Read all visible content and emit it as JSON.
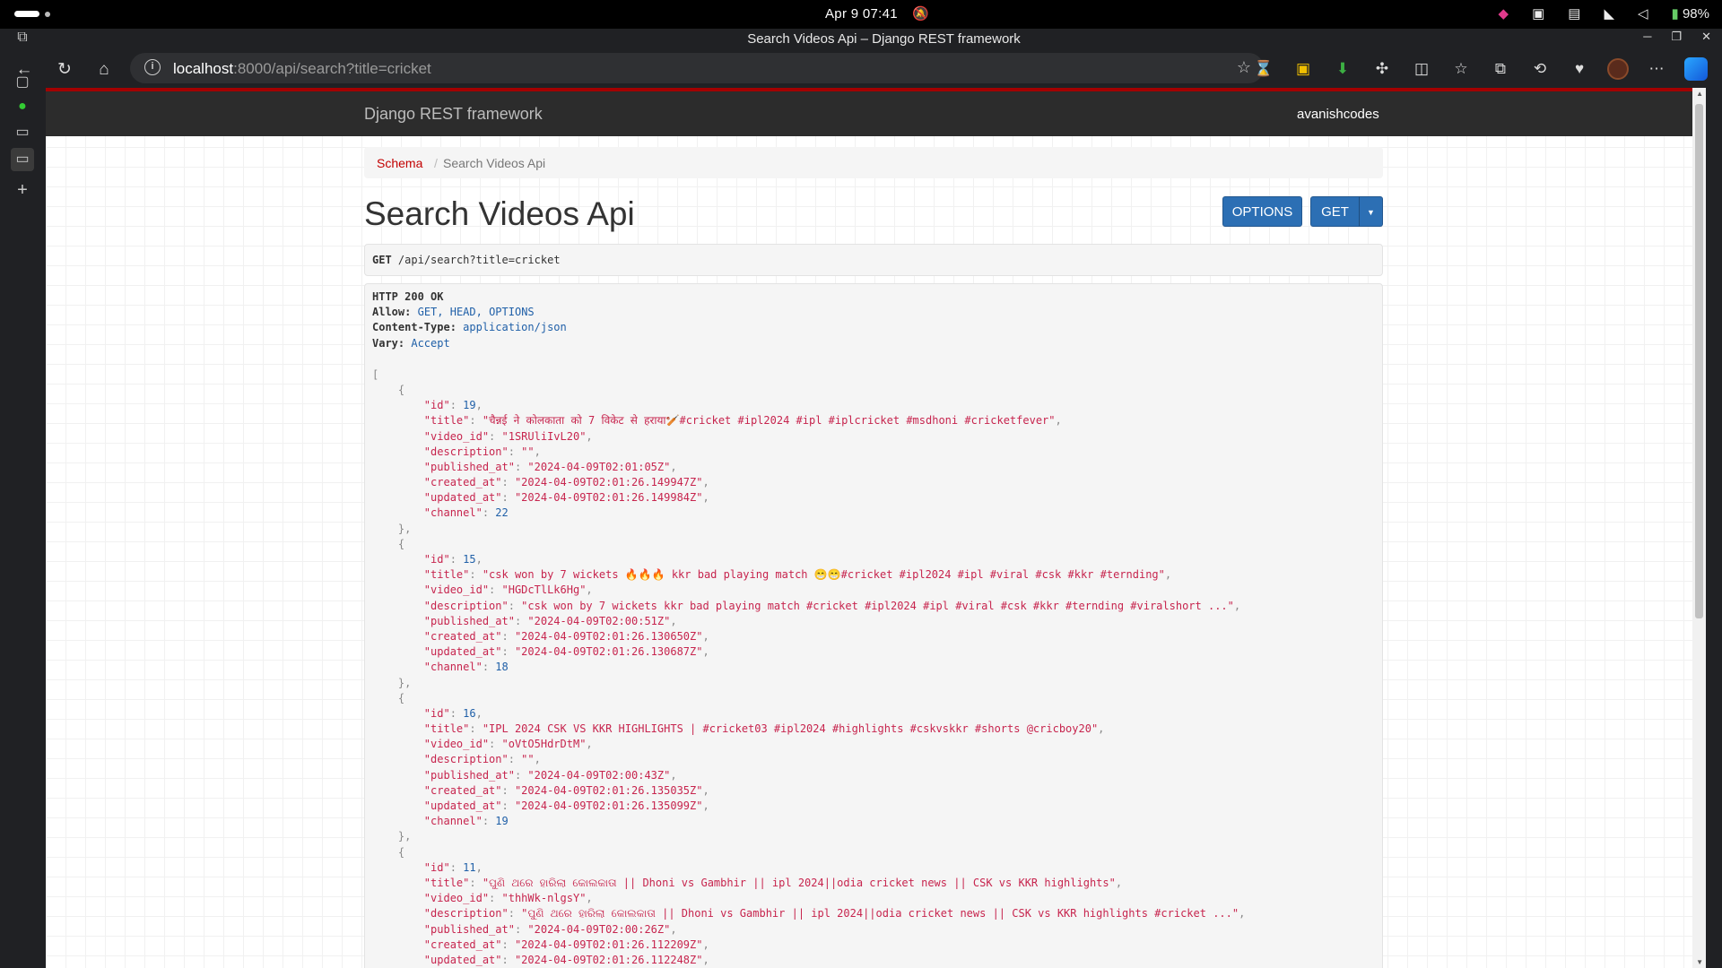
{
  "os": {
    "clock": "Apr 9  07:41",
    "battery": "98%"
  },
  "browser": {
    "window_title": "Search Videos Api – Django REST framework",
    "url_host": "localhost",
    "url_rest": ":8000/api/search?title=cricket"
  },
  "drf": {
    "brand": "Django REST framework",
    "user": "avanishcodes",
    "breadcrumb": {
      "link": "Schema",
      "separator": "/",
      "current": "Search Videos Api"
    },
    "page_title": "Search Videos Api",
    "options_label": "OPTIONS",
    "get_label": "GET",
    "request": {
      "method": "GET",
      "path": "/api/search?title=cricket"
    },
    "response_headers": {
      "status": "HTTP 200 OK",
      "allow_key": "Allow:",
      "allow_val": "GET, HEAD, OPTIONS",
      "ctype_key": "Content-Type:",
      "ctype_val": "application/json",
      "vary_key": "Vary:",
      "vary_val": "Accept"
    },
    "items": [
      {
        "id": "19",
        "title": "\"चैन्नई ने कोलकाता को 7 विकेट से हराया🏏#cricket #ipl2024 #ipl #iplcricket #msdhoni #cricketfever\"",
        "video_id": "\"1SRUliIvL20\"",
        "description": "\"\"",
        "published_at": "\"2024-04-09T02:01:05Z\"",
        "created_at": "\"2024-04-09T02:01:26.149947Z\"",
        "updated_at": "\"2024-04-09T02:01:26.149984Z\"",
        "channel": "22"
      },
      {
        "id": "15",
        "title": "\"csk won by 7 wickets 🔥🔥🔥 kkr bad playing match 😁😁#cricket #ipl2024 #ipl #viral #csk #kkr #ternding\"",
        "video_id": "\"HGDcTlLk6Hg\"",
        "description": "\"csk won by 7 wickets kkr bad playing match #cricket #ipl2024 #ipl #viral #csk #kkr #ternding #viralshort ...\"",
        "published_at": "\"2024-04-09T02:00:51Z\"",
        "created_at": "\"2024-04-09T02:01:26.130650Z\"",
        "updated_at": "\"2024-04-09T02:01:26.130687Z\"",
        "channel": "18"
      },
      {
        "id": "16",
        "title": "\"IPL 2024 CSK VS KKR HIGHLIGHTS | #cricket03 #ipl2024 #highlights #cskvskkr #shorts @cricboy20\"",
        "video_id": "\"oVtO5HdrDtM\"",
        "description": "\"\"",
        "published_at": "\"2024-04-09T02:00:43Z\"",
        "created_at": "\"2024-04-09T02:01:26.135035Z\"",
        "updated_at": "\"2024-04-09T02:01:26.135099Z\"",
        "channel": "19"
      },
      {
        "id": "11",
        "title": "\"ପୁଣି ଥରେ ହାରିଲା କୋଲକାତା || Dhoni vs Gambhir || ipl 2024||odia cricket news || CSK vs KKR highlights\"",
        "video_id": "\"thhWk-nlgsY\"",
        "description": "\"ପୁଣି ଥରେ ହାରିଲା କୋଲକାତା || Dhoni vs Gambhir || ipl 2024||odia cricket news || CSK vs KKR highlights #cricket ...\"",
        "published_at": "\"2024-04-09T02:00:26Z\"",
        "created_at": "\"2024-04-09T02:01:26.112209Z\"",
        "updated_at": "\"2024-04-09T02:01:26.112248Z\"",
        "channel": ""
      }
    ]
  }
}
